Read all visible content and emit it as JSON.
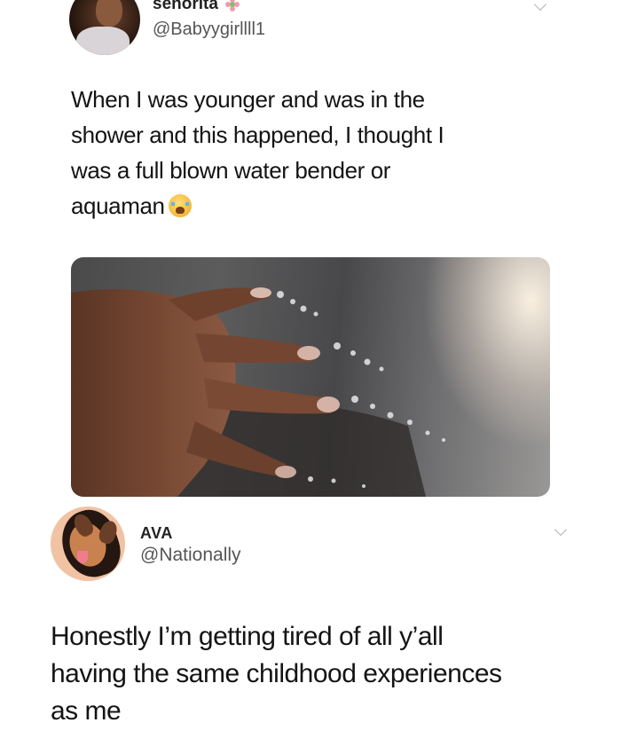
{
  "tweet1": {
    "name": "senorita",
    "name_icon": "flower-icon",
    "handle": "@Babyygirllll1",
    "text_lines": [
      "When I was younger and was in the",
      "shower and this happened, I thought I",
      "was a full blown water bender or",
      "aquaman"
    ],
    "trailing_emoji": "loudly-crying-face-icon",
    "media": {
      "type": "photo",
      "icon": "hand-splashing-water-photo"
    }
  },
  "tweet2": {
    "name": "AVA",
    "handle": "@Nationally",
    "text_lines": [
      "Honestly I’m getting tired of all y’all",
      "having the same childhood experiences",
      "as me"
    ]
  },
  "colors": {
    "background": "#ffffff",
    "text": "#141414",
    "handle": "#555555",
    "chevron": "#b3b3b3"
  }
}
